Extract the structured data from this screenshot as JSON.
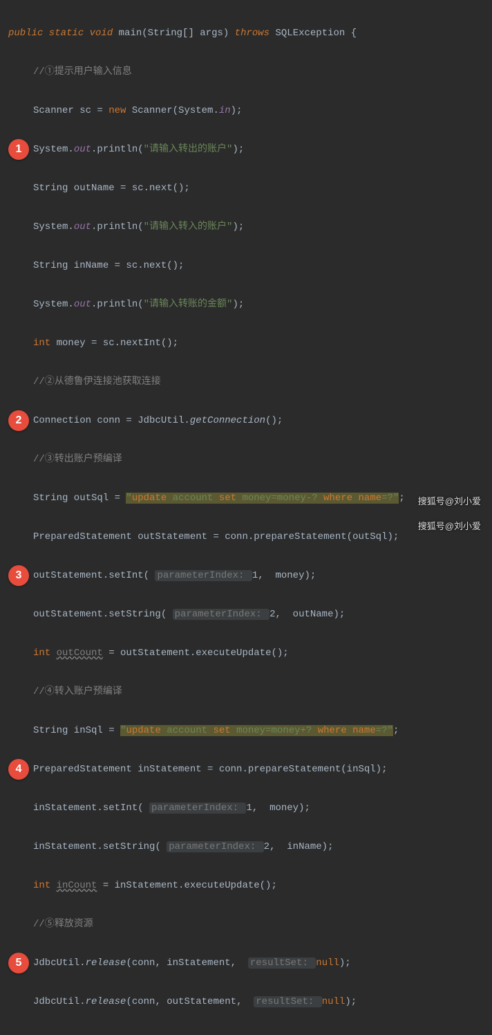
{
  "badges": [
    "1",
    "2",
    "3",
    "4",
    "5"
  ],
  "watermarks": [
    "搜狐号@刘小爱",
    "搜狐号@刘小爱"
  ],
  "code": {
    "sig": {
      "p1": "public static void ",
      "main": "main",
      "p2": "(String[] args) ",
      "thr": "throws ",
      "ex": "SQLException ",
      "br": "{"
    },
    "c1": "//①提示用户输入信息",
    "l2": {
      "a": "Scanner sc = ",
      "nw": "new ",
      "b": "Scanner(System.",
      "in": "in",
      "c": ");"
    },
    "l3": {
      "a": "System.",
      "o": "out",
      "b": ".println(",
      "s": "\"请输入转出的账户\"",
      "c": ");"
    },
    "l4": "String outName = sc.next();",
    "l5": {
      "a": "System.",
      "o": "out",
      "b": ".println(",
      "s": "\"请输入转入的账户\"",
      "c": ");"
    },
    "l6": "String inName = sc.next();",
    "l7": {
      "a": "System.",
      "o": "out",
      "b": ".println(",
      "s": "\"请输入转账的金额\"",
      "c": ");"
    },
    "l8": {
      "k": "int ",
      "b": "money = sc.nextInt();"
    },
    "c2": "//②从德鲁伊连接池获取连接",
    "l9": {
      "a": "Connection conn = JdbcUtil.",
      "m": "getConnection",
      "b": "();"
    },
    "c3": "//③转出账户预编译",
    "l10": {
      "a": "String outSql = ",
      "q": "\"",
      "u": "update ",
      "t1": "account ",
      "se": "set ",
      "t2": "money=money-? ",
      "wh": "where ",
      "nm": "name",
      "eq": "=?",
      "q2": "\"",
      "c": ";"
    },
    "l11": "PreparedStatement outStatement = conn.prepareStatement(outSql);",
    "l12": {
      "a": "outStatement.setInt( ",
      "h": "parameterIndex: ",
      "v": "1",
      "b": ",  money);"
    },
    "l13": {
      "a": "outStatement.setString( ",
      "h": "parameterIndex: ",
      "v": "2",
      "b": ",  outName);"
    },
    "l14": {
      "k": "int ",
      "u": "outCount",
      "b": " = outStatement.executeUpdate();"
    },
    "c4": "//④转入账户预编译",
    "l15": {
      "a": "String inSql = ",
      "q": "\"",
      "u": "update ",
      "t1": "account ",
      "se": "set ",
      "t2": "money=money+? ",
      "wh": "where ",
      "nm": "name",
      "eq": "=?",
      "q2": "\"",
      "c": ";"
    },
    "l16": "PreparedStatement inStatement = conn.prepareStatement(inSql);",
    "l17": {
      "a": "inStatement.setInt( ",
      "h": "parameterIndex: ",
      "v": "1",
      "b": ",  money);"
    },
    "l18": {
      "a": "inStatement.setString( ",
      "h": "parameterIndex: ",
      "v": "2",
      "b": ",  inName);"
    },
    "l19": {
      "k": "int ",
      "u": "inCount",
      "b": " = inStatement.executeUpdate();"
    },
    "c5": "//⑤释放资源",
    "l20": {
      "a": "JdbcUtil.",
      "m": "release",
      "b": "(conn, inStatement,  ",
      "h": "resultSet: ",
      "n": "null",
      "c": ");"
    },
    "l21": {
      "a": "JdbcUtil.",
      "m": "release",
      "b": "(conn, outStatement,  ",
      "h": "resultSet: ",
      "n": "null",
      "c": ");"
    }
  }
}
